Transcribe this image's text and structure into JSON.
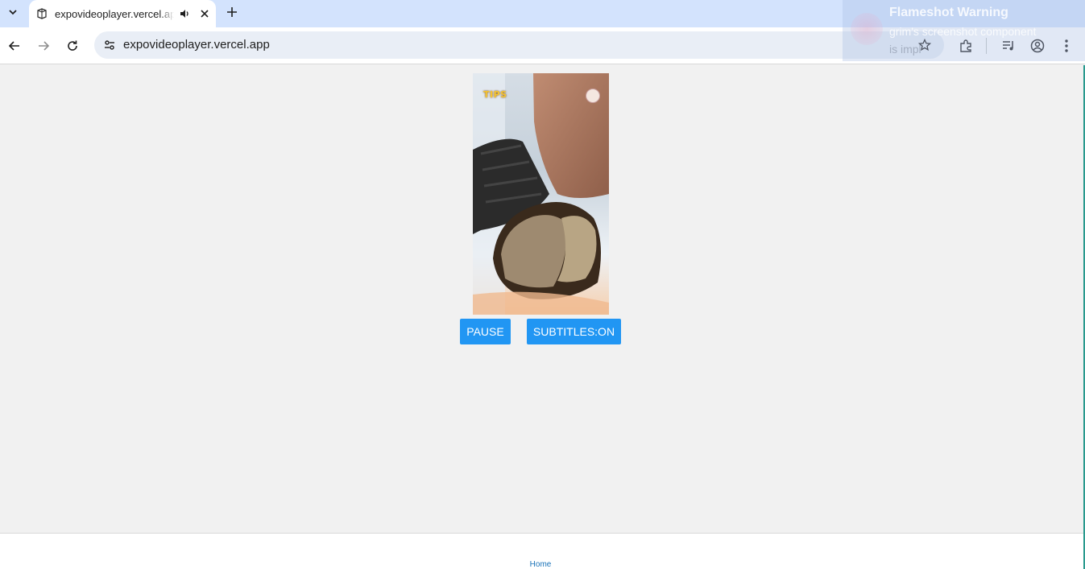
{
  "browser": {
    "tab": {
      "title": "expovideoplayer.vercel.app"
    },
    "address_bar": {
      "url": "expovideoplayer.vercel.app"
    }
  },
  "notification": {
    "title": "Flameshot Warning",
    "line1": "grim's screenshot component",
    "line2": "is implemented based on wlroots"
  },
  "video": {
    "watermark": "TIPS"
  },
  "controls": {
    "pause_label": "PAUSE",
    "subtitles_label": "SUBTITLES:ON"
  },
  "footer": {
    "home_link": "Home"
  },
  "colors": {
    "button": "#2196f3",
    "tabstrip": "#d3e3fd",
    "page_bg": "#f1f1f1"
  }
}
